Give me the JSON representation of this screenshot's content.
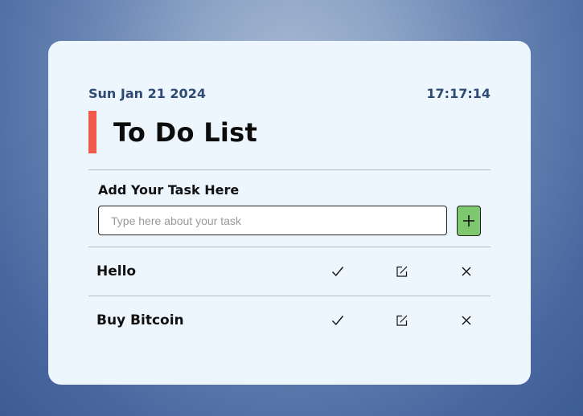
{
  "header": {
    "date": "Sun Jan 21 2024",
    "time": "17:17:14",
    "title": "To Do List"
  },
  "add_task": {
    "label": "Add Your Task Here",
    "placeholder": "Type here about your task",
    "value": "",
    "button_icon": "plus-icon"
  },
  "tasks": [
    {
      "name": "Hello",
      "actions": [
        "check-icon",
        "edit-icon",
        "close-icon"
      ]
    },
    {
      "name": "Buy Bitcoin",
      "actions": [
        "check-icon",
        "edit-icon",
        "close-icon"
      ]
    }
  ],
  "colors": {
    "accent_bar": "#ef5a4a",
    "add_button": "#7fc76e",
    "date_text": "#2f4b73",
    "card_background": "#eef6fd"
  }
}
